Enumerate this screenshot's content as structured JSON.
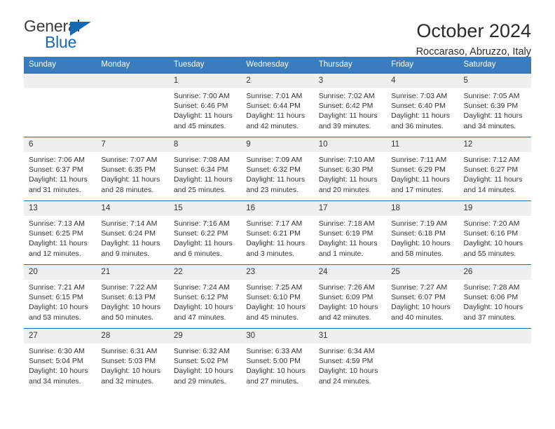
{
  "logo": {
    "word_top": "General",
    "word_bottom": "Blue",
    "accent_color": "#1668b3"
  },
  "header": {
    "title": "October 2024",
    "subtitle": "Roccaraso, Abruzzo, Italy"
  },
  "theme": {
    "header_blue": "#3a7cbe",
    "rule_blue": "#2e6ca8",
    "daynum_bg": "#efefef"
  },
  "calendar": {
    "weekday_headers": [
      "Sunday",
      "Monday",
      "Tuesday",
      "Wednesday",
      "Thursday",
      "Friday",
      "Saturday"
    ],
    "weeks": [
      [
        {
          "day": ""
        },
        {
          "day": ""
        },
        {
          "day": "1",
          "sunrise": "Sunrise: 7:00 AM",
          "sunset": "Sunset: 6:46 PM",
          "daylight": "Daylight: 11 hours and 45 minutes."
        },
        {
          "day": "2",
          "sunrise": "Sunrise: 7:01 AM",
          "sunset": "Sunset: 6:44 PM",
          "daylight": "Daylight: 11 hours and 42 minutes."
        },
        {
          "day": "3",
          "sunrise": "Sunrise: 7:02 AM",
          "sunset": "Sunset: 6:42 PM",
          "daylight": "Daylight: 11 hours and 39 minutes."
        },
        {
          "day": "4",
          "sunrise": "Sunrise: 7:03 AM",
          "sunset": "Sunset: 6:40 PM",
          "daylight": "Daylight: 11 hours and 36 minutes."
        },
        {
          "day": "5",
          "sunrise": "Sunrise: 7:05 AM",
          "sunset": "Sunset: 6:39 PM",
          "daylight": "Daylight: 11 hours and 34 minutes."
        }
      ],
      [
        {
          "day": "6",
          "sunrise": "Sunrise: 7:06 AM",
          "sunset": "Sunset: 6:37 PM",
          "daylight": "Daylight: 11 hours and 31 minutes."
        },
        {
          "day": "7",
          "sunrise": "Sunrise: 7:07 AM",
          "sunset": "Sunset: 6:35 PM",
          "daylight": "Daylight: 11 hours and 28 minutes."
        },
        {
          "day": "8",
          "sunrise": "Sunrise: 7:08 AM",
          "sunset": "Sunset: 6:34 PM",
          "daylight": "Daylight: 11 hours and 25 minutes."
        },
        {
          "day": "9",
          "sunrise": "Sunrise: 7:09 AM",
          "sunset": "Sunset: 6:32 PM",
          "daylight": "Daylight: 11 hours and 23 minutes."
        },
        {
          "day": "10",
          "sunrise": "Sunrise: 7:10 AM",
          "sunset": "Sunset: 6:30 PM",
          "daylight": "Daylight: 11 hours and 20 minutes."
        },
        {
          "day": "11",
          "sunrise": "Sunrise: 7:11 AM",
          "sunset": "Sunset: 6:29 PM",
          "daylight": "Daylight: 11 hours and 17 minutes."
        },
        {
          "day": "12",
          "sunrise": "Sunrise: 7:12 AM",
          "sunset": "Sunset: 6:27 PM",
          "daylight": "Daylight: 11 hours and 14 minutes."
        }
      ],
      [
        {
          "day": "13",
          "sunrise": "Sunrise: 7:13 AM",
          "sunset": "Sunset: 6:25 PM",
          "daylight": "Daylight: 11 hours and 12 minutes."
        },
        {
          "day": "14",
          "sunrise": "Sunrise: 7:14 AM",
          "sunset": "Sunset: 6:24 PM",
          "daylight": "Daylight: 11 hours and 9 minutes."
        },
        {
          "day": "15",
          "sunrise": "Sunrise: 7:16 AM",
          "sunset": "Sunset: 6:22 PM",
          "daylight": "Daylight: 11 hours and 6 minutes."
        },
        {
          "day": "16",
          "sunrise": "Sunrise: 7:17 AM",
          "sunset": "Sunset: 6:21 PM",
          "daylight": "Daylight: 11 hours and 3 minutes."
        },
        {
          "day": "17",
          "sunrise": "Sunrise: 7:18 AM",
          "sunset": "Sunset: 6:19 PM",
          "daylight": "Daylight: 11 hours and 1 minute."
        },
        {
          "day": "18",
          "sunrise": "Sunrise: 7:19 AM",
          "sunset": "Sunset: 6:18 PM",
          "daylight": "Daylight: 10 hours and 58 minutes."
        },
        {
          "day": "19",
          "sunrise": "Sunrise: 7:20 AM",
          "sunset": "Sunset: 6:16 PM",
          "daylight": "Daylight: 10 hours and 55 minutes."
        }
      ],
      [
        {
          "day": "20",
          "sunrise": "Sunrise: 7:21 AM",
          "sunset": "Sunset: 6:15 PM",
          "daylight": "Daylight: 10 hours and 53 minutes."
        },
        {
          "day": "21",
          "sunrise": "Sunrise: 7:22 AM",
          "sunset": "Sunset: 6:13 PM",
          "daylight": "Daylight: 10 hours and 50 minutes."
        },
        {
          "day": "22",
          "sunrise": "Sunrise: 7:24 AM",
          "sunset": "Sunset: 6:12 PM",
          "daylight": "Daylight: 10 hours and 47 minutes."
        },
        {
          "day": "23",
          "sunrise": "Sunrise: 7:25 AM",
          "sunset": "Sunset: 6:10 PM",
          "daylight": "Daylight: 10 hours and 45 minutes."
        },
        {
          "day": "24",
          "sunrise": "Sunrise: 7:26 AM",
          "sunset": "Sunset: 6:09 PM",
          "daylight": "Daylight: 10 hours and 42 minutes."
        },
        {
          "day": "25",
          "sunrise": "Sunrise: 7:27 AM",
          "sunset": "Sunset: 6:07 PM",
          "daylight": "Daylight: 10 hours and 40 minutes."
        },
        {
          "day": "26",
          "sunrise": "Sunrise: 7:28 AM",
          "sunset": "Sunset: 6:06 PM",
          "daylight": "Daylight: 10 hours and 37 minutes."
        }
      ],
      [
        {
          "day": "27",
          "sunrise": "Sunrise: 6:30 AM",
          "sunset": "Sunset: 5:04 PM",
          "daylight": "Daylight: 10 hours and 34 minutes."
        },
        {
          "day": "28",
          "sunrise": "Sunrise: 6:31 AM",
          "sunset": "Sunset: 5:03 PM",
          "daylight": "Daylight: 10 hours and 32 minutes."
        },
        {
          "day": "29",
          "sunrise": "Sunrise: 6:32 AM",
          "sunset": "Sunset: 5:02 PM",
          "daylight": "Daylight: 10 hours and 29 minutes."
        },
        {
          "day": "30",
          "sunrise": "Sunrise: 6:33 AM",
          "sunset": "Sunset: 5:00 PM",
          "daylight": "Daylight: 10 hours and 27 minutes."
        },
        {
          "day": "31",
          "sunrise": "Sunrise: 6:34 AM",
          "sunset": "Sunset: 4:59 PM",
          "daylight": "Daylight: 10 hours and 24 minutes."
        },
        {
          "day": ""
        },
        {
          "day": ""
        }
      ]
    ]
  }
}
